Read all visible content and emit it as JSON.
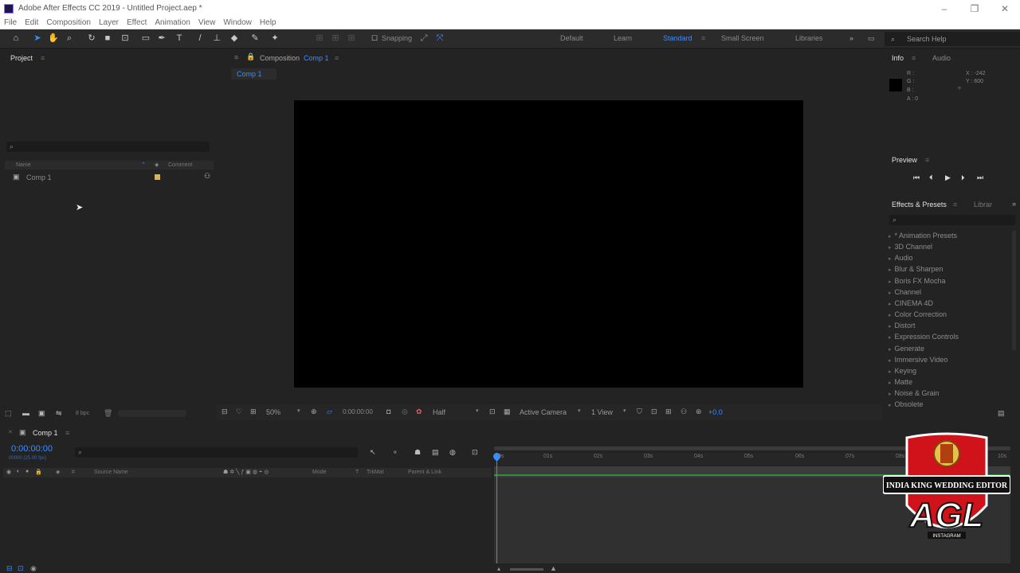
{
  "window": {
    "title": "Adobe After Effects CC 2019 - Untitled Project.aep *",
    "min": "–",
    "max": "❐",
    "close": "✕"
  },
  "menu": [
    "File",
    "Edit",
    "Composition",
    "Layer",
    "Effect",
    "Animation",
    "View",
    "Window",
    "Help"
  ],
  "toolbar": {
    "snapping": "Snapping",
    "workspaces": [
      {
        "label": "Default",
        "active": false
      },
      {
        "label": "Learn",
        "active": false
      },
      {
        "label": "Standard",
        "active": true
      },
      {
        "label": "Small Screen",
        "active": false
      },
      {
        "label": "Libraries",
        "active": false
      }
    ],
    "search_help": "Search Help"
  },
  "project_panel": {
    "tab": "Project",
    "col_name": "Name",
    "col_comment": "Comment",
    "items": [
      {
        "name": "Comp 1"
      }
    ],
    "bpc": "8 bpc"
  },
  "composition_panel": {
    "tab_prefix": "Composition",
    "tab_comp": "Comp 1",
    "subtab": "Comp 1",
    "zoom": "50%",
    "timecode": "0:00:00:00",
    "resolution": "Half",
    "camera": "Active Camera",
    "views": "1 View",
    "exposure": "+0.0"
  },
  "info_panel": {
    "tab_info": "Info",
    "tab_audio": "Audio",
    "r": "R :",
    "g": "G :",
    "b": "B :",
    "a": "A : 0",
    "x": "X : -242",
    "y": "Y : 600"
  },
  "preview_panel": {
    "tab": "Preview"
  },
  "effects_panel": {
    "tab": "Effects & Presets",
    "tab2": "Librar",
    "items": [
      "* Animation Presets",
      "3D Channel",
      "Audio",
      "Blur & Sharpen",
      "Boris FX Mocha",
      "Channel",
      "CINEMA 4D",
      "Color Correction",
      "Distort",
      "Expression Controls",
      "Generate",
      "Immersive Video",
      "Keying",
      "Matte",
      "Noise & Grain",
      "Obsolete"
    ]
  },
  "timeline": {
    "tab": "Comp 1",
    "timecode": "0:00:00:00",
    "fps": "00000 (25.00 fps)",
    "col_source": "Source Name",
    "col_mode": "Mode",
    "col_trkmat": "TrkMat",
    "col_parent": "Parent & Link",
    "ruler": [
      "0s",
      "01s",
      "02s",
      "03s",
      "04s",
      "05s",
      "06s",
      "07s",
      "08s",
      "10s"
    ]
  },
  "logo": {
    "top_text": "INDIA KING WEDDING EDITOR",
    "main": "AGL",
    "bottom": "INSTAGRAM"
  },
  "colors": {
    "accent": "#3d8cff",
    "panel": "#232323",
    "logo_red": "#d0121b"
  }
}
